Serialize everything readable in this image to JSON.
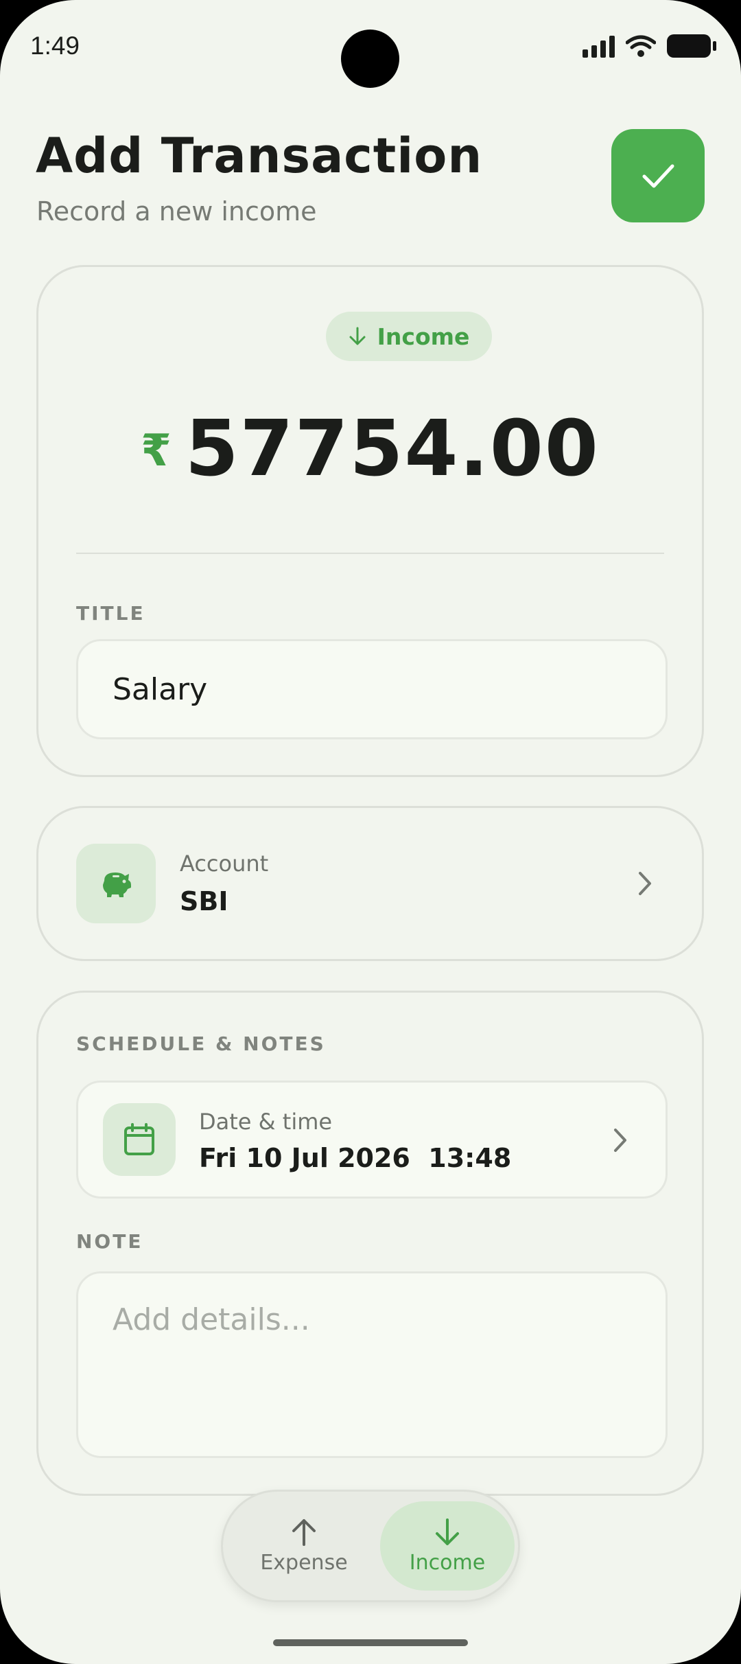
{
  "status_bar": {
    "time": "1:49"
  },
  "header": {
    "title": "Add Transaction",
    "subtitle": "Record a new income"
  },
  "amount_card": {
    "type_chip": "Income",
    "currency_symbol": "₹",
    "amount": "57754.00",
    "title_label": "TITLE",
    "title_value": "Salary"
  },
  "account": {
    "caption": "Account",
    "value": "SBI",
    "icon": "piggy-bank-icon"
  },
  "schedule": {
    "section_label": "SCHEDULE & NOTES",
    "date_caption": "Date & time",
    "date_value": "Fri 10 Jul 2026  13:48",
    "note_label": "NOTE",
    "note_placeholder": "Add details..."
  },
  "type_toggle": {
    "expense_label": "Expense",
    "income_label": "Income",
    "selected": "Income"
  },
  "colors": {
    "accent": "#4caf50",
    "accent_text": "#43a047",
    "chip_bg": "#dcebd8",
    "background": "#f2f5ee"
  }
}
